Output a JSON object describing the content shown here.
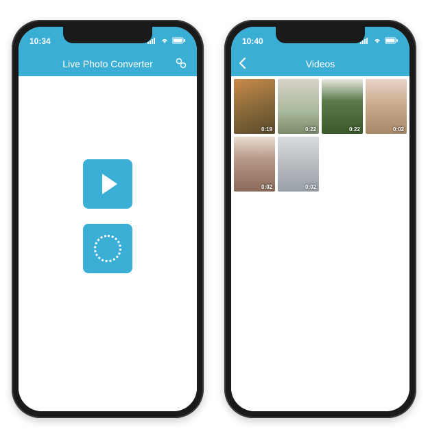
{
  "accent": "#3baed6",
  "phone1": {
    "status": {
      "time": "10:34"
    },
    "nav": {
      "title": "Live Photo Converter"
    },
    "buttons": {
      "play": "play",
      "loading": "loading"
    }
  },
  "phone2": {
    "status": {
      "time": "10:40"
    },
    "nav": {
      "title": "Videos"
    },
    "videos": [
      {
        "duration": "0:19"
      },
      {
        "duration": "0:22"
      },
      {
        "duration": "0:22"
      },
      {
        "duration": "0:02"
      },
      {
        "duration": "0:02"
      },
      {
        "duration": "0:02"
      }
    ]
  }
}
